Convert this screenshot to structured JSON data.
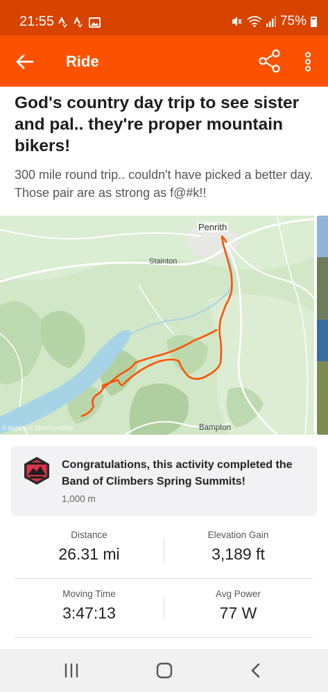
{
  "status_bar": {
    "time": "21:55",
    "battery": "75%",
    "icons": [
      "strava-notification-icon",
      "strava-notification-icon",
      "gallery-icon",
      "mute-icon",
      "wifi-icon",
      "signal-icon",
      "battery-icon"
    ]
  },
  "app_bar": {
    "title": "Ride",
    "icons": [
      "back-arrow-icon",
      "share-icon",
      "more-vertical-icon"
    ]
  },
  "activity": {
    "title": "God's country day trip to see sister and pal.. they're proper mountain bikers!",
    "description": "300 mile round trip.. couldn't have picked a better day. Those pair are as strong as f@#k!!"
  },
  "map": {
    "labels": {
      "penrith": "Penrith",
      "stainton": "Stainton",
      "bampton": "Bampton",
      "attribution": "© Mapbox © OpenStreetMap"
    },
    "route_color": "#fc5200"
  },
  "challenge": {
    "text": "Congratulations, this activity completed the Band of Climbers Spring Summits!",
    "sub": "1,000 m",
    "badge_icon": "band-of-climbers-badge-icon"
  },
  "stats": {
    "distance": {
      "label": "Distance",
      "value": "26.31 mi"
    },
    "elevation": {
      "label": "Elevation Gain",
      "value": "3,189 ft"
    },
    "moving_time": {
      "label": "Moving Time",
      "value": "3:47:13"
    },
    "avg_power": {
      "label": "Avg Power",
      "value": "77 W"
    }
  },
  "nav_bar": {
    "icons": [
      "recent-apps-icon",
      "home-icon",
      "back-icon"
    ]
  },
  "colors": {
    "status_bar": "#d84300",
    "brand": "#fc5200",
    "card_bg": "#f2f2f4"
  }
}
